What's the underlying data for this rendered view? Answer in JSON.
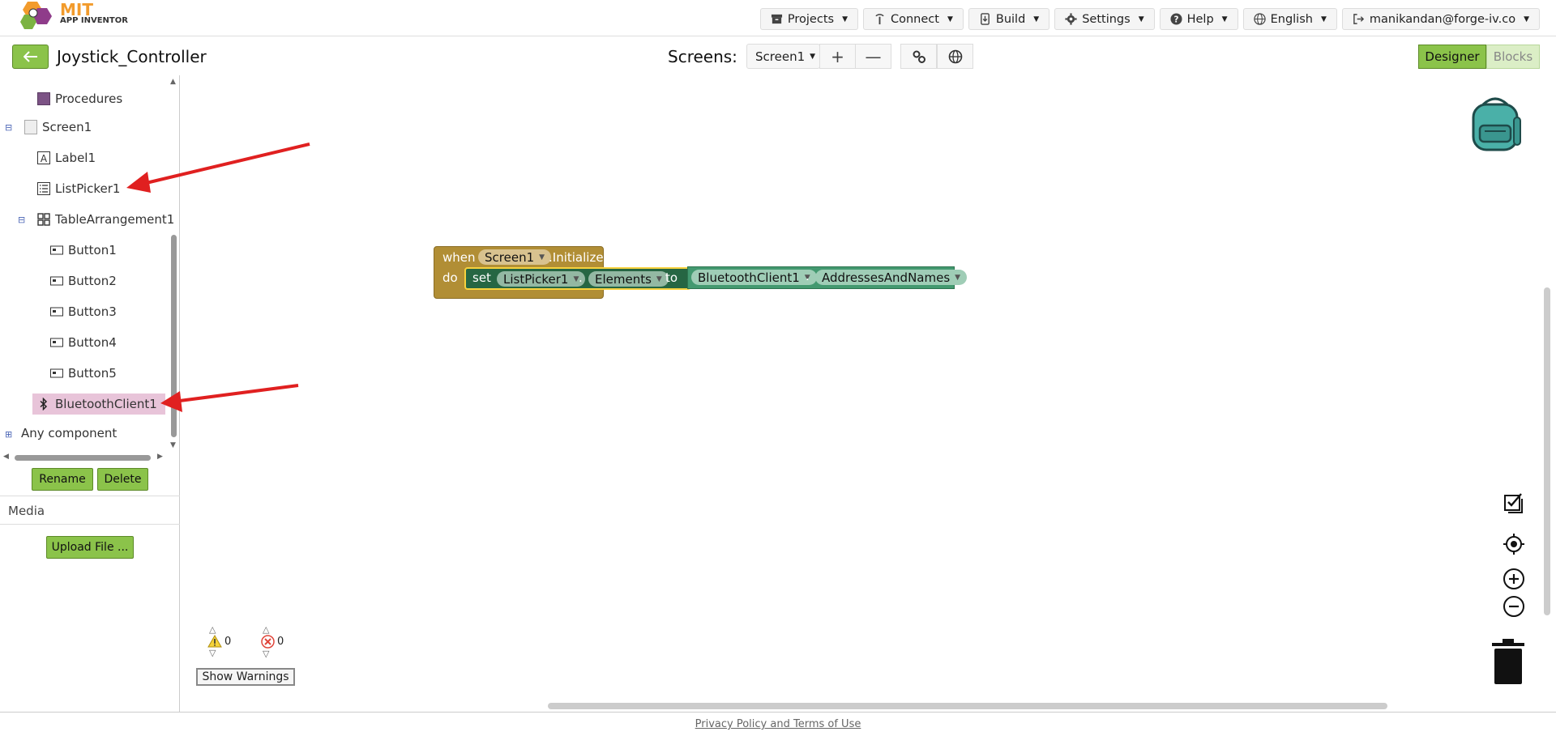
{
  "app": {
    "logo_title": "MIT",
    "logo_subtitle": "APP INVENTOR"
  },
  "topnav": {
    "items": [
      {
        "label": "Projects",
        "icon": "archive-icon"
      },
      {
        "label": "Connect",
        "icon": "antenna-icon"
      },
      {
        "label": "Build",
        "icon": "phone-download-icon"
      },
      {
        "label": "Settings",
        "icon": "gear-icon"
      },
      {
        "label": "Help",
        "icon": "question-icon"
      },
      {
        "label": "English",
        "icon": "globe-icon"
      },
      {
        "label": "manikandan@forge-iv.co",
        "icon": "logout-icon"
      }
    ]
  },
  "project": {
    "name": "Joystick_Controller",
    "screens_label": "Screens:",
    "current_screen": "Screen1",
    "add_screen": "+",
    "remove_screen": "—",
    "designer_label": "Designer",
    "blocks_label": "Blocks"
  },
  "tree": {
    "procedures": "Procedures",
    "screen": "Screen1",
    "label": "Label1",
    "listpicker": "ListPicker1",
    "table": "TableArrangement1",
    "buttons": [
      "Button1",
      "Button2",
      "Button3",
      "Button4",
      "Button5"
    ],
    "bluetooth": "BluetoothClient1",
    "any_component": "Any component"
  },
  "panel": {
    "rename_label": "Rename",
    "delete_label": "Delete",
    "media_label": "Media",
    "upload_label": "Upload File ..."
  },
  "block": {
    "when": "when",
    "event_component": "Screen1",
    "event_name": ".Initialize",
    "do": "do",
    "set": "set",
    "set_component": "ListPicker1",
    "dot": ".",
    "set_property": "Elements",
    "to": "to",
    "get_component": "BluetoothClient1",
    "get_property": "AddressesAndNames"
  },
  "warnings": {
    "warning_count": "0",
    "error_count": "0",
    "show_warnings_label": "Show Warnings"
  },
  "footer": {
    "privacy_link": "Privacy Policy and Terms of Use"
  },
  "colors": {
    "accent_green": "#8bc34a",
    "event_block": "#b18e35",
    "set_block": "#266643",
    "bluetooth_block": "#439970",
    "selected_item": "#e8c4d9",
    "annotation_arrow": "#e02020"
  }
}
